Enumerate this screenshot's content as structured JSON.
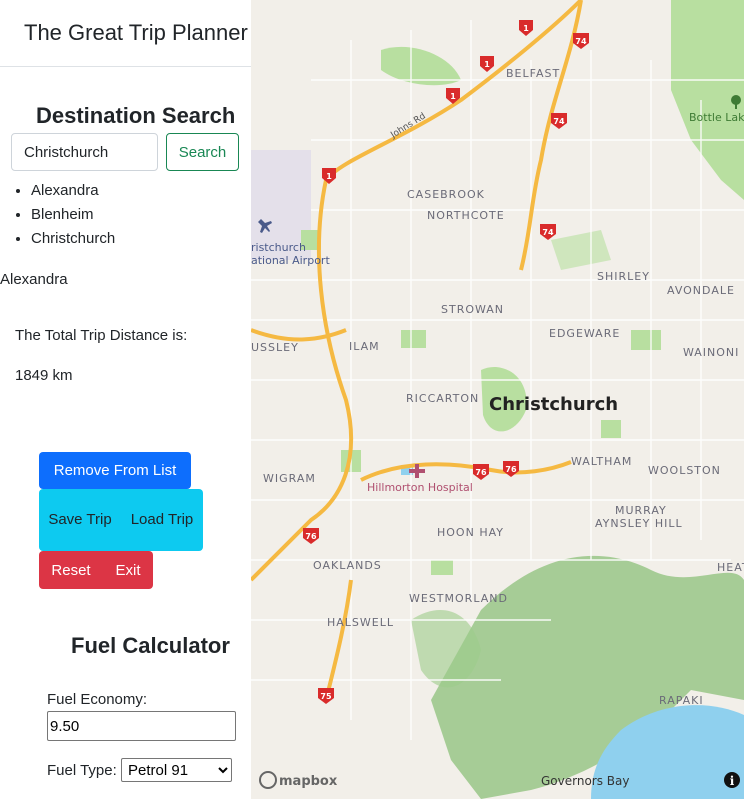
{
  "app": {
    "title": "The Great Trip Planner"
  },
  "search": {
    "heading": "Destination Search",
    "input_value": "Christchurch",
    "button_label": "Search"
  },
  "destinations": [
    "Alexandra",
    "Blenheim",
    "Christchurch"
  ],
  "selected_destination": "Alexandra",
  "distance": {
    "label": "The Total Trip Distance is:",
    "value": "1849 km"
  },
  "actions": {
    "remove_label": "Remove From List",
    "save_label": "Save Trip",
    "load_label": "Load Trip",
    "reset_label": "Reset",
    "exit_label": "Exit"
  },
  "fuel": {
    "heading": "Fuel Calculator",
    "economy_label": "Fuel Economy:",
    "economy_value": "9.50",
    "type_label": "Fuel Type:",
    "type_value": "Petrol 91"
  },
  "map": {
    "city_label": "Christchurch",
    "suburbs": [
      "BELFAST",
      "CASEBROOK",
      "NORTHCOTE",
      "SHIRLEY",
      "AVONDALE",
      "STROWAN",
      "EDGEWARE",
      "WAINONI",
      "USSLEY",
      "ILAM",
      "RICCARTON",
      "WALTHAM",
      "WOOLSTON",
      "WIGRAM",
      "HOON HAY",
      "MURRAY",
      "AYNSLEY HILL",
      "OAKLANDS",
      "WESTMORLAND",
      "HALSWELL",
      "RAPAKI",
      "HEAT"
    ],
    "places": [
      "Bottle Lake",
      "ristchurch",
      "ational Airport",
      "Hillmorton Hospital",
      "Governors Bay",
      "Johns Rd"
    ],
    "highway_numbers": [
      "1",
      "74",
      "76",
      "75"
    ],
    "attribution": "mapbox",
    "colors": {
      "land": "#f2efe9",
      "park": "#b8dfa0",
      "water": "#8fd0ee",
      "highway": "#f5b942",
      "hill": "#8cc07a"
    }
  }
}
